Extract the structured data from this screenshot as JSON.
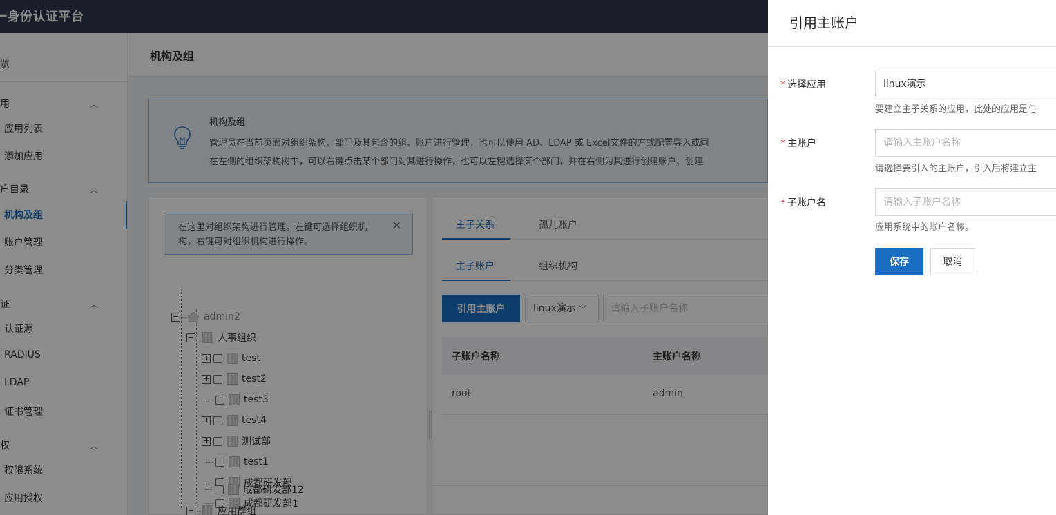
{
  "header": {
    "platform_title": "一身份认证平台"
  },
  "sidebar": {
    "items": [
      {
        "label": "览",
        "type": "group"
      },
      {
        "label": "用",
        "type": "group"
      },
      {
        "label": "应用列表",
        "type": "sub"
      },
      {
        "label": "添加应用",
        "type": "sub"
      },
      {
        "label": "户目录",
        "type": "group"
      },
      {
        "label": "机构及组",
        "type": "sub",
        "active": true
      },
      {
        "label": "账户管理",
        "type": "sub"
      },
      {
        "label": "分类管理",
        "type": "sub"
      },
      {
        "label": "证",
        "type": "group"
      },
      {
        "label": "认证源",
        "type": "sub"
      },
      {
        "label": "RADIUS",
        "type": "sub"
      },
      {
        "label": "LDAP",
        "type": "sub"
      },
      {
        "label": "证书管理",
        "type": "sub"
      },
      {
        "label": "权",
        "type": "group"
      },
      {
        "label": "权限系统",
        "type": "sub"
      },
      {
        "label": "应用授权",
        "type": "sub"
      }
    ]
  },
  "main": {
    "page_title": "机构及组",
    "info": {
      "title": "机构及组",
      "line1": "管理员在当前页面对组织架构、部门及其包含的组、账户进行管理，也可以使用 AD、LDAP 或 Excel文件的方式配置导入或同",
      "line2": "在左侧的组织架构树中，可以右键点击某个部门对其进行操作，也可以左键选择某个部门，并在右侧为其进行创建账户、创建"
    },
    "tree_tip": "在这里对组织架构进行管理。左键可选择组织机构，右键可对组织机构进行操作。",
    "tree": {
      "root": "admin2",
      "org": "人事组织",
      "children": [
        "test",
        "test2",
        "test3",
        "test4",
        "测试部",
        "test1",
        "成都研发部",
        "成都研发部1",
        "成都研发部12"
      ],
      "group": "应用群组"
    },
    "tabs_top": [
      "主子关系",
      "孤儿账户"
    ],
    "tabs_sub": [
      "主子账户",
      "组织机构"
    ],
    "cite_button": "引用主账户",
    "app_select_value": "linux演示",
    "sub_search_placeholder": "请输入子账户名称",
    "table": {
      "headers": [
        "子账户名称",
        "主账户名称"
      ],
      "rows": [
        {
          "sub": "root",
          "main": "admin"
        }
      ]
    }
  },
  "drawer": {
    "title": "引用主账户",
    "fields": {
      "app": {
        "label": "选择应用",
        "value": "linux演示",
        "help": "要建立主子关系的应用，此处的应用是与"
      },
      "main_account": {
        "label": "主账户",
        "placeholder": "请输入主账户名称",
        "help": "请选择要引入的主账户，引入后将建立主"
      },
      "sub_account": {
        "label": "子账户名",
        "placeholder": "请输入子账户名称",
        "help": "应用系统中的账户名称。"
      }
    },
    "save_label": "保存",
    "cancel_label": "取消"
  },
  "colors": {
    "primary": "#1a6fc4",
    "header_bg": "#2f3a4d",
    "required": "#e4393c"
  }
}
